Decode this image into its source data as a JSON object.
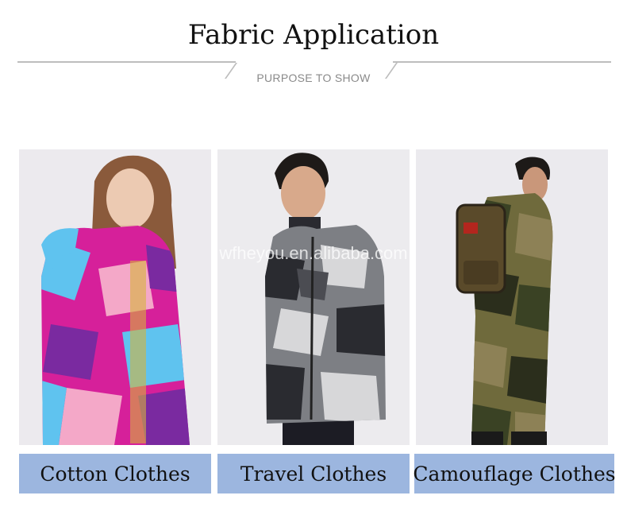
{
  "header": {
    "title": "Fabric Application",
    "subtitle": "PURPOSE TO SHOW"
  },
  "watermark": "wfheyou.en.alibaba.com",
  "products": [
    {
      "label": "Cotton Clothes",
      "image": "woman in pink and blue camouflage jacket"
    },
    {
      "label": "Travel Clothes",
      "image": "man in grey camouflage jacket"
    },
    {
      "label": "Camouflage Clothes",
      "image": "man in green woodland camouflage uniform with backpack"
    }
  ],
  "colors": {
    "label_background": "#9cb6df",
    "rule": "#bdbdbd",
    "photo_background": "#eaeaee"
  }
}
